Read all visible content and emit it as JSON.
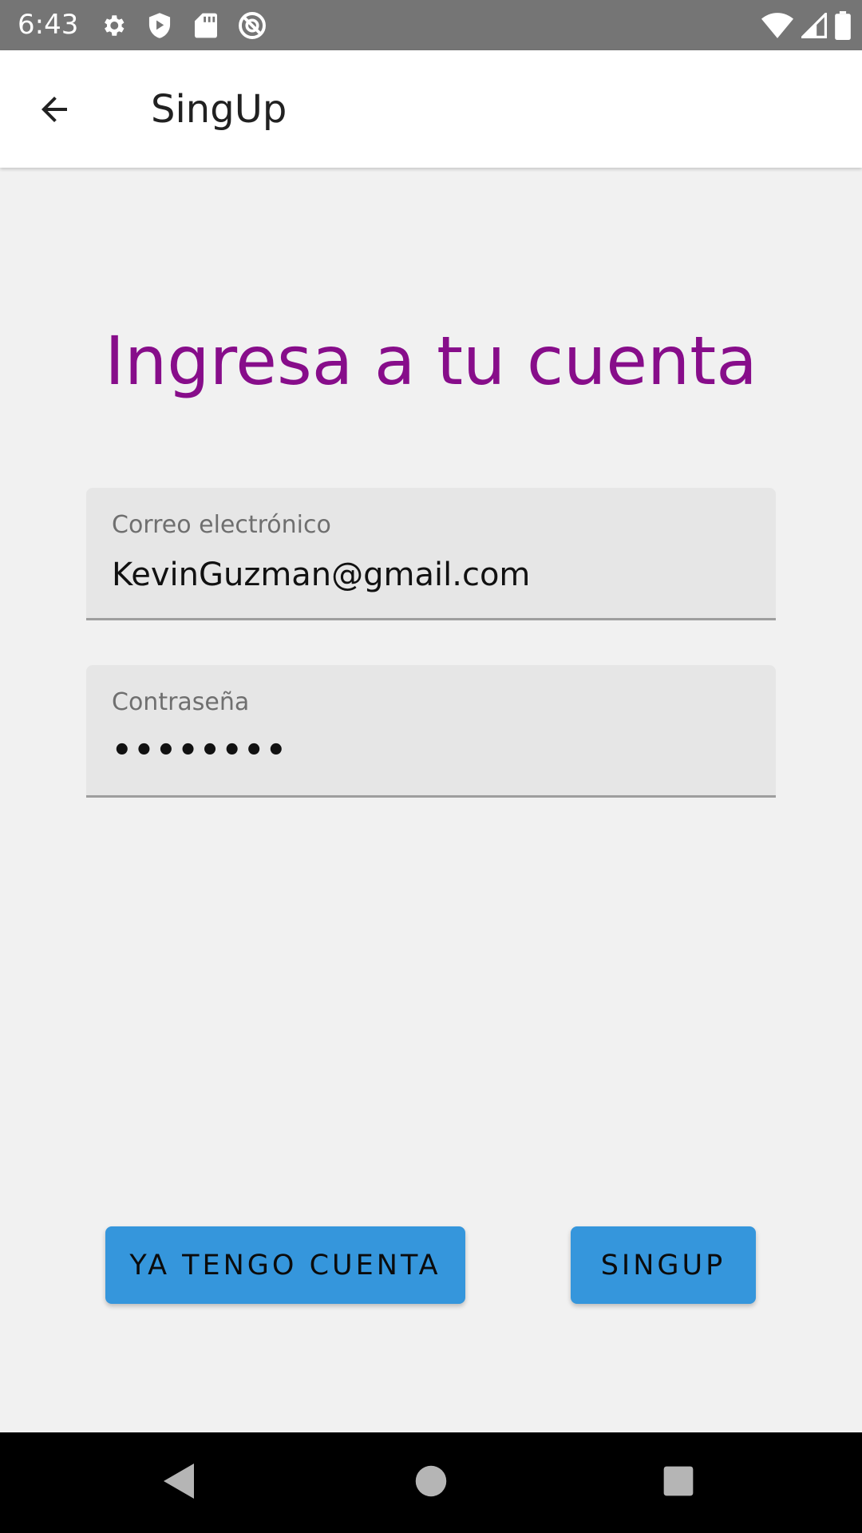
{
  "status_bar": {
    "time": "6:43",
    "icons_left": [
      "gear-icon",
      "shield-icon",
      "sd-card-icon",
      "do-not-disturb-icon"
    ],
    "icons_right": [
      "wifi-icon",
      "cell-signal-icon",
      "battery-icon"
    ]
  },
  "app_bar": {
    "title": "SingUp",
    "back_icon": "arrow-back-icon"
  },
  "heading": "Ingresa a tu cuenta",
  "form": {
    "email": {
      "label": "Correo electrónico",
      "value": "KevinGuzman@gmail.com"
    },
    "password": {
      "label": "Contraseña",
      "value": "••••••••"
    }
  },
  "buttons": {
    "login_label": "YA TENGO CUENTA",
    "signup_label": "SINGUP"
  },
  "nav_bar": {
    "icons": [
      "nav-back-icon",
      "nav-home-icon",
      "nav-recents-icon"
    ]
  },
  "colors": {
    "heading": "#870d8a",
    "button": "#3596dc",
    "status_bar": "#757575",
    "field_bg": "#e6e6e6"
  }
}
